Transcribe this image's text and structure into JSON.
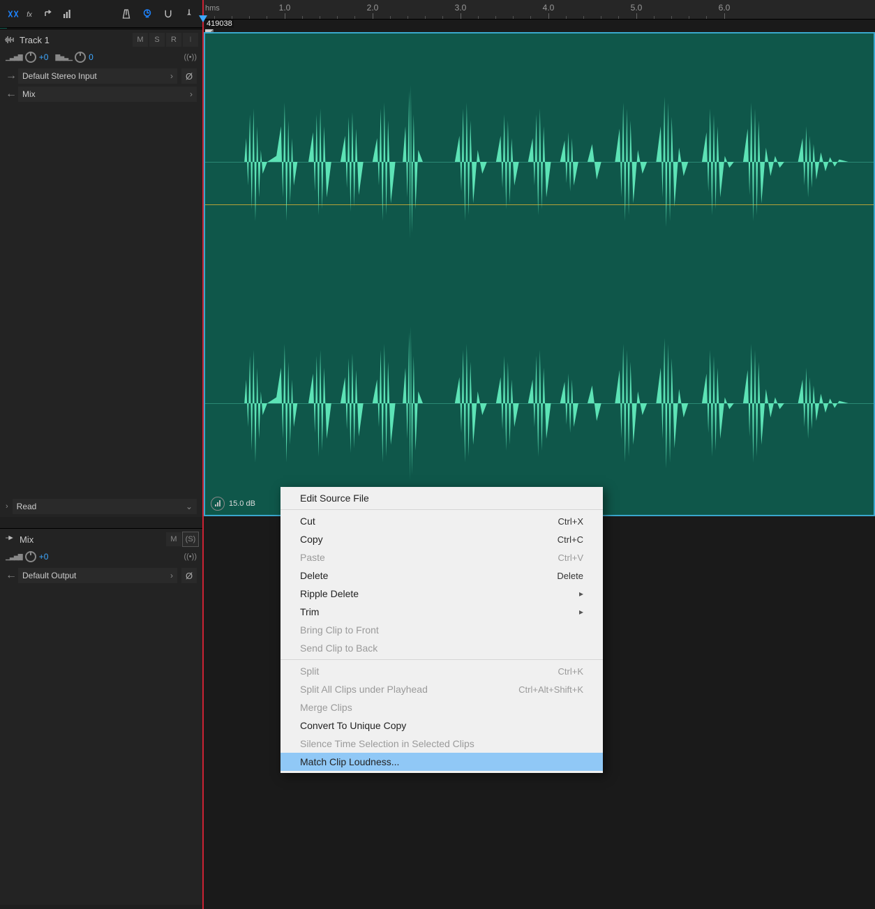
{
  "inspector": {
    "tools_left": [
      "crossfade",
      "fx",
      "envelope",
      "eq"
    ],
    "tools_right": [
      "metronome",
      "prelisten",
      "snap",
      "pin"
    ]
  },
  "ruler": {
    "unit": "hms",
    "ticks": [
      {
        "pos": 118,
        "label": "1.0"
      },
      {
        "pos": 244,
        "label": "2.0"
      },
      {
        "pos": 370,
        "label": "3.0"
      },
      {
        "pos": 496,
        "label": "4.0"
      },
      {
        "pos": 622,
        "label": "5.0"
      },
      {
        "pos": 748,
        "label": "6.0"
      }
    ]
  },
  "track1": {
    "name": "Track 1",
    "buttons": {
      "m": "M",
      "s": "S",
      "r": "R",
      "i": "I"
    },
    "volume_label": "+0",
    "pan_label": "0",
    "input": "Default Stereo Input",
    "output": "Mix",
    "automation": "Read"
  },
  "mixtrack": {
    "name": "Mix",
    "buttons": {
      "m": "M",
      "s": "(S)"
    },
    "volume_label": "+0",
    "output": "Default Output"
  },
  "clip": {
    "file_label": "419038",
    "db_label": "15.0 dB"
  },
  "context_menu": [
    {
      "label": "Edit Source File"
    },
    {
      "sep": true
    },
    {
      "label": "Cut",
      "shortcut": "Ctrl+X"
    },
    {
      "label": "Copy",
      "shortcut": "Ctrl+C"
    },
    {
      "label": "Paste",
      "shortcut": "Ctrl+V",
      "disabled": true
    },
    {
      "label": "Delete",
      "shortcut": "Delete"
    },
    {
      "label": "Ripple Delete",
      "submenu": true
    },
    {
      "label": "Trim",
      "submenu": true
    },
    {
      "label": "Bring Clip to Front",
      "disabled": true
    },
    {
      "label": "Send Clip to Back",
      "disabled": true
    },
    {
      "sep": true
    },
    {
      "label": "Split",
      "shortcut": "Ctrl+K",
      "disabled": true
    },
    {
      "label": "Split All Clips under Playhead",
      "shortcut": "Ctrl+Alt+Shift+K",
      "disabled": true
    },
    {
      "label": "Merge Clips",
      "disabled": true
    },
    {
      "label": "Convert To Unique Copy"
    },
    {
      "label": "Silence Time Selection in Selected Clips",
      "disabled": true
    },
    {
      "label": "Match Clip Loudness...",
      "highlight": true
    }
  ]
}
